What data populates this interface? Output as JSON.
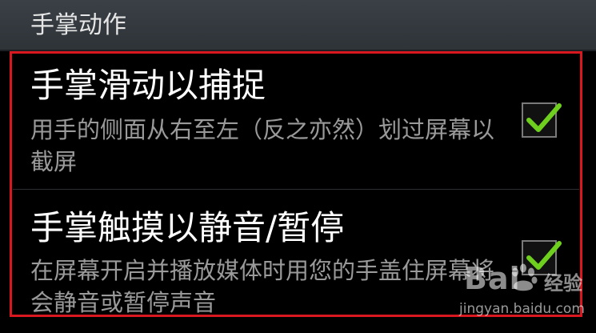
{
  "header": {
    "title": "手掌动作"
  },
  "settings": {
    "items": [
      {
        "title": "手掌滑动以捕捉",
        "description": "用手的侧面从右至左（反之亦然）划过屏幕以截屏",
        "checked": true
      },
      {
        "title": "手掌触摸以静音/暂停",
        "description": "在屏幕开启并播放媒体时用您的手盖住屏幕将会静音或暂停声音",
        "checked": true
      }
    ]
  },
  "theme": {
    "background": "#000000",
    "header_bg": "#33393e",
    "check_color": "#6fcf1f",
    "highlight_border": "#d8171f"
  },
  "watermark": {
    "logo_text_left": "Bai",
    "logo_text_right": "经验",
    "url": "jingyan.baidu.com"
  }
}
